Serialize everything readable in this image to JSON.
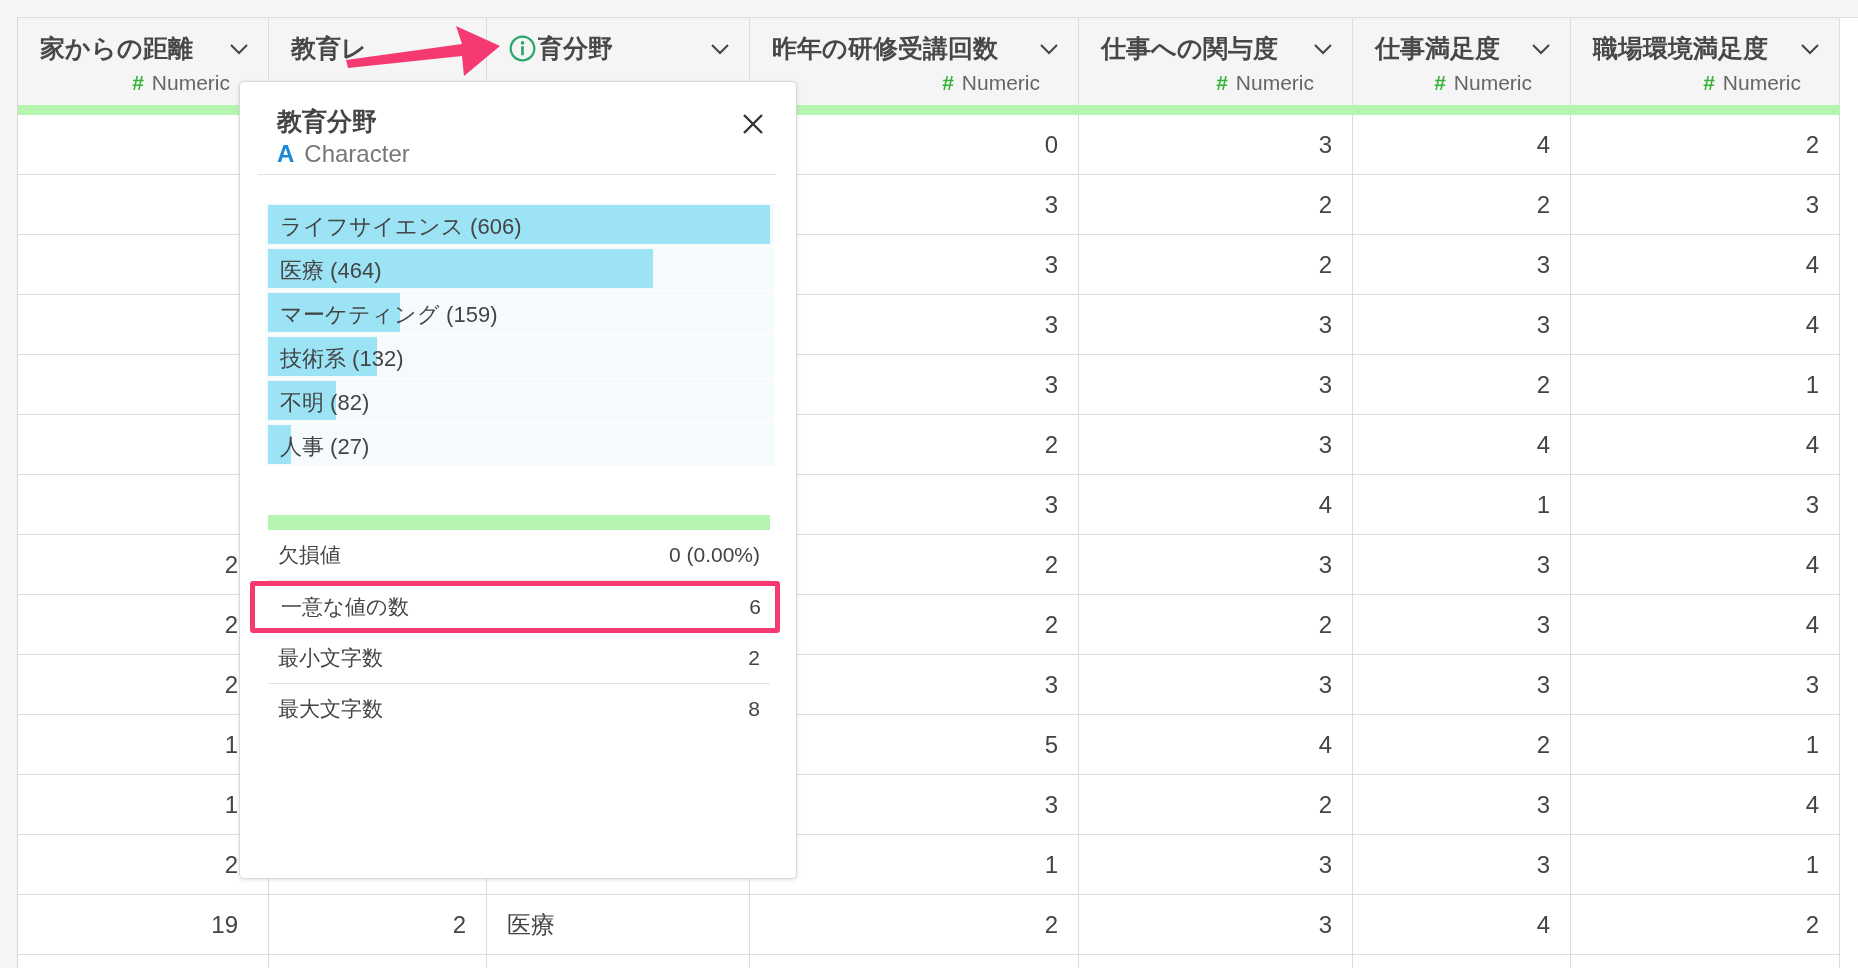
{
  "table": {
    "columns": [
      {
        "title": "家からの距離",
        "type": "Numeric",
        "type_symbol": "#",
        "menu": true
      },
      {
        "title": "教育レ",
        "menu": false
      },
      {
        "title": "育分野",
        "info": true,
        "menu": true
      },
      {
        "title": "昨年の研修受講回数",
        "type": "Numeric",
        "type_symbol": "#",
        "menu": true
      },
      {
        "title": "仕事への関与度",
        "type": "Numeric",
        "type_symbol": "#",
        "menu": true
      },
      {
        "title": "仕事満足度",
        "type": "Numeric",
        "type_symbol": "#",
        "menu": true
      },
      {
        "title": "職場環境満足度",
        "type": "Numeric",
        "type_symbol": "#",
        "menu": true
      }
    ],
    "rows": [
      {
        "cells": [
          null,
          null,
          null,
          "0",
          "3",
          "4",
          "2"
        ]
      },
      {
        "cells": [
          null,
          null,
          null,
          "3",
          "2",
          "2",
          "3"
        ]
      },
      {
        "cells": [
          null,
          null,
          null,
          "3",
          "2",
          "3",
          "4"
        ]
      },
      {
        "cells": [
          null,
          null,
          null,
          "3",
          "3",
          "3",
          "4"
        ]
      },
      {
        "cells": [
          null,
          null,
          null,
          "3",
          "3",
          "2",
          "1"
        ]
      },
      {
        "cells": [
          null,
          null,
          null,
          "2",
          "3",
          "4",
          "4"
        ]
      },
      {
        "cells": [
          null,
          null,
          null,
          "3",
          "4",
          "1",
          "3"
        ]
      },
      {
        "cells": [
          "2",
          null,
          null,
          "2",
          "3",
          "3",
          "4"
        ]
      },
      {
        "cells": [
          "2",
          null,
          null,
          "2",
          "2",
          "3",
          "4"
        ]
      },
      {
        "cells": [
          "2",
          null,
          null,
          "3",
          "3",
          "3",
          "3"
        ]
      },
      {
        "cells": [
          "1",
          null,
          null,
          "5",
          "4",
          "2",
          "1"
        ]
      },
      {
        "cells": [
          "1",
          null,
          null,
          "3",
          "2",
          "3",
          "4"
        ]
      },
      {
        "cells": [
          "2",
          null,
          null,
          "1",
          "3",
          "3",
          "1"
        ]
      },
      {
        "cells": [
          "19",
          "2",
          "医療",
          "2",
          "3",
          "4",
          "2"
        ]
      },
      {
        "cells": [
          null,
          null,
          null,
          null,
          null,
          null,
          null
        ]
      }
    ]
  },
  "popup": {
    "title": "教育分野",
    "type": "Character",
    "type_symbol": "A",
    "bars": [
      {
        "label": "ライフサイエンス (606)",
        "level": 1
      },
      {
        "label": "医療 (464)",
        "level": 0.766
      },
      {
        "label": "マーケティング (159)",
        "level": 0.262
      },
      {
        "label": "技術系 (132)",
        "level": 0.218
      },
      {
        "label": "不明 (82)",
        "level": 0.135
      },
      {
        "label": "人事 (27)",
        "level": 0.045
      }
    ],
    "valid_bar": {
      "level": 1
    },
    "stats": [
      {
        "label": "欠損値",
        "value": "0 (0.00%)",
        "highlighted": false
      },
      {
        "label": "一意な値の数",
        "value": "6",
        "highlighted": true
      },
      {
        "label": "最小文字数",
        "value": "2",
        "highlighted": false
      },
      {
        "label": "最大文字数",
        "value": "8",
        "highlighted": false
      }
    ]
  },
  "annotation_arrow": true
}
